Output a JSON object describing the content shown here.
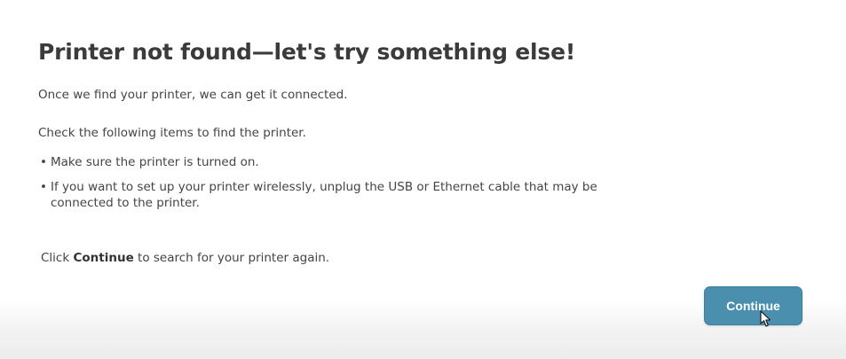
{
  "dialog": {
    "title": "Printer not found—let's try something else!",
    "intro": "Once we find your printer, we can get it connected.",
    "check_heading": "Check the following items to find the printer.",
    "bullets": [
      "Make sure the printer is turned on.",
      "If you want to set up your printer wirelessly, unplug the USB or Ethernet cable that may be connected to the printer."
    ],
    "bullet_glyph": "•",
    "footer_prefix": "Click ",
    "footer_bold": "Continue",
    "footer_suffix": " to search for your printer again.",
    "continue_label": "Continue"
  },
  "colors": {
    "button_bg": "#4a8fae",
    "text": "#444444",
    "title": "#3b3b3b"
  },
  "icons": {
    "cursor": "pointer-cursor-icon"
  }
}
